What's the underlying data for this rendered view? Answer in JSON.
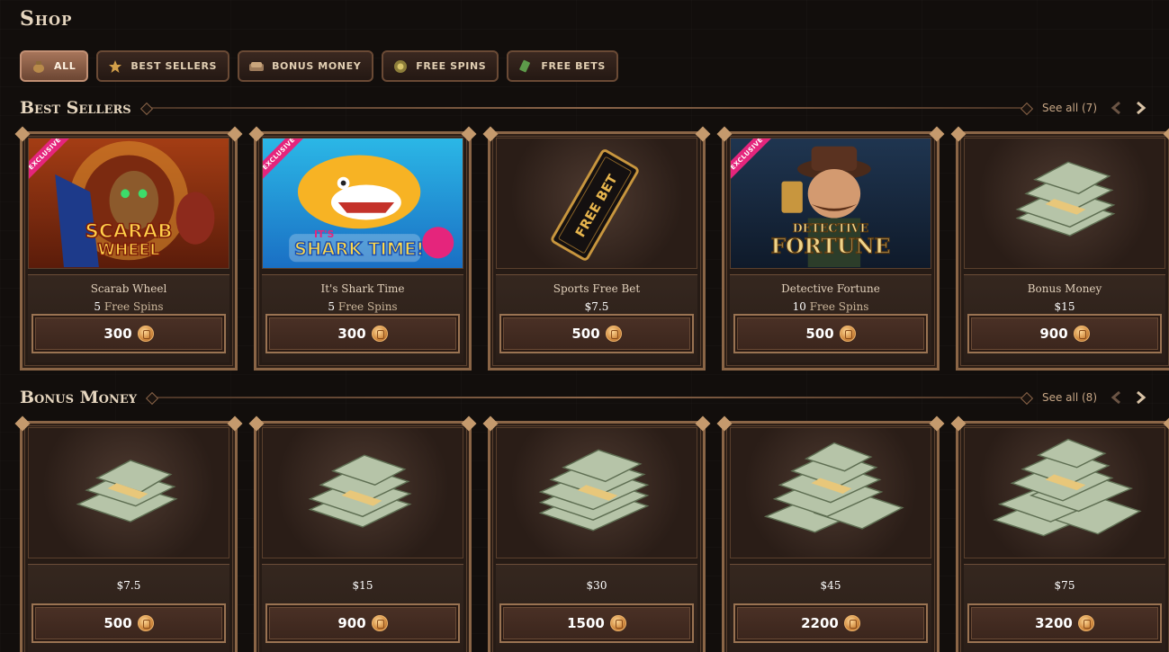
{
  "page": {
    "title": "Shop"
  },
  "filters": [
    {
      "label": "ALL",
      "icon": "coin-bag-icon",
      "active": true
    },
    {
      "label": "BEST SELLERS",
      "icon": "star-icon",
      "active": false
    },
    {
      "label": "BONUS MONEY",
      "icon": "money-icon",
      "active": false
    },
    {
      "label": "FREE SPINS",
      "icon": "spin-icon",
      "active": false
    },
    {
      "label": "FREE BETS",
      "icon": "ticket-icon",
      "active": false
    }
  ],
  "best_sellers": {
    "title": "Best Sellers",
    "see_all": "See all (7)",
    "items": [
      {
        "name": "Scarab Wheel",
        "qty": "5",
        "unit": "Free Spins",
        "price": "300",
        "badge": "EXCLUSIVE",
        "art_text": [
          "SCARAB",
          "WHEEL"
        ]
      },
      {
        "name": "It's Shark Time",
        "qty": "5",
        "unit": "Free Spins",
        "price": "300",
        "badge": "EXCLUSIVE",
        "art_text": [
          "IT'S",
          "SHARK TIME!"
        ]
      },
      {
        "name": "Sports Free Bet",
        "qty": "$7.5",
        "unit": "",
        "price": "500",
        "badge": "",
        "art_text": [
          "FREE BET"
        ]
      },
      {
        "name": "Detective Fortune",
        "qty": "10",
        "unit": "Free Spins",
        "price": "500",
        "badge": "EXCLUSIVE",
        "art_text": [
          "DETECTIVE",
          "FORTUNE"
        ]
      },
      {
        "name": "Bonus Money",
        "qty": "$15",
        "unit": "",
        "price": "900",
        "badge": "",
        "art_text": []
      }
    ]
  },
  "bonus_money": {
    "title": "Bonus Money",
    "see_all": "See all (8)",
    "items": [
      {
        "qty": "$7.5",
        "price": "500"
      },
      {
        "qty": "$15",
        "price": "900"
      },
      {
        "qty": "$30",
        "price": "1500"
      },
      {
        "qty": "$45",
        "price": "2200"
      },
      {
        "qty": "$75",
        "price": "3200"
      }
    ]
  },
  "colors": {
    "accent": "#c29074",
    "badge": "#e5257c",
    "coin": "#d0893e",
    "bg": "#120e0c"
  }
}
